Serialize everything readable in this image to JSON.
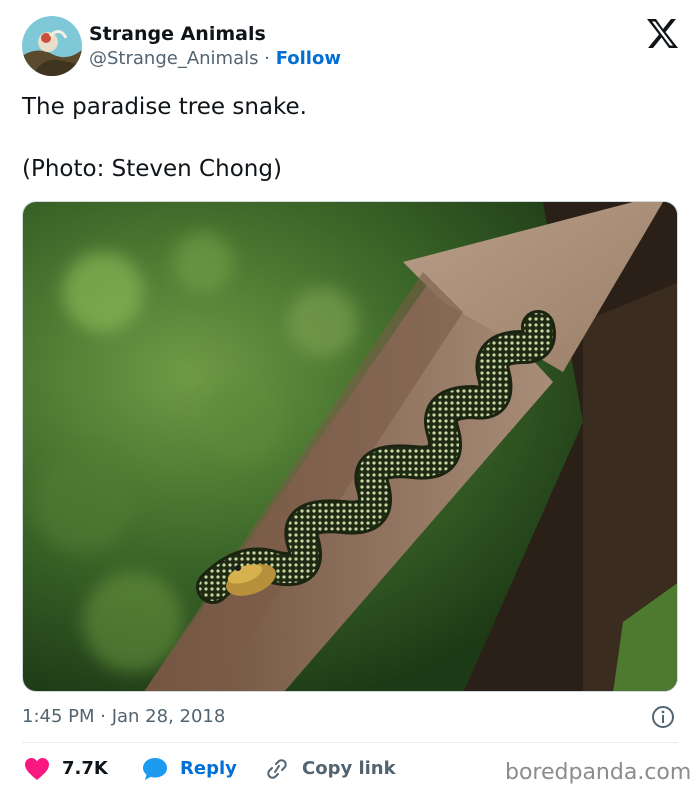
{
  "header": {
    "display_name": "Strange Animals",
    "handle": "@Strange_Animals",
    "separator": "·",
    "follow_label": "Follow"
  },
  "tweet": {
    "lines": [
      "The paradise tree snake.",
      "(Photo: Steven Chong)"
    ]
  },
  "photo": {
    "subject": "paradise tree snake on wooden railing"
  },
  "meta": {
    "timestamp": "1:45 PM · Jan 28, 2018"
  },
  "actions": {
    "likes": "7.7K",
    "reply_label": "Reply",
    "copy_link_label": "Copy link"
  },
  "watermark": "boredpanda.com",
  "colors": {
    "heart": "#f91880",
    "accent_blue": "#006fd6",
    "secondary_text": "#536471"
  },
  "icons": [
    "x-logo-icon",
    "info-icon",
    "heart-icon",
    "reply-bubble-icon",
    "link-icon"
  ]
}
